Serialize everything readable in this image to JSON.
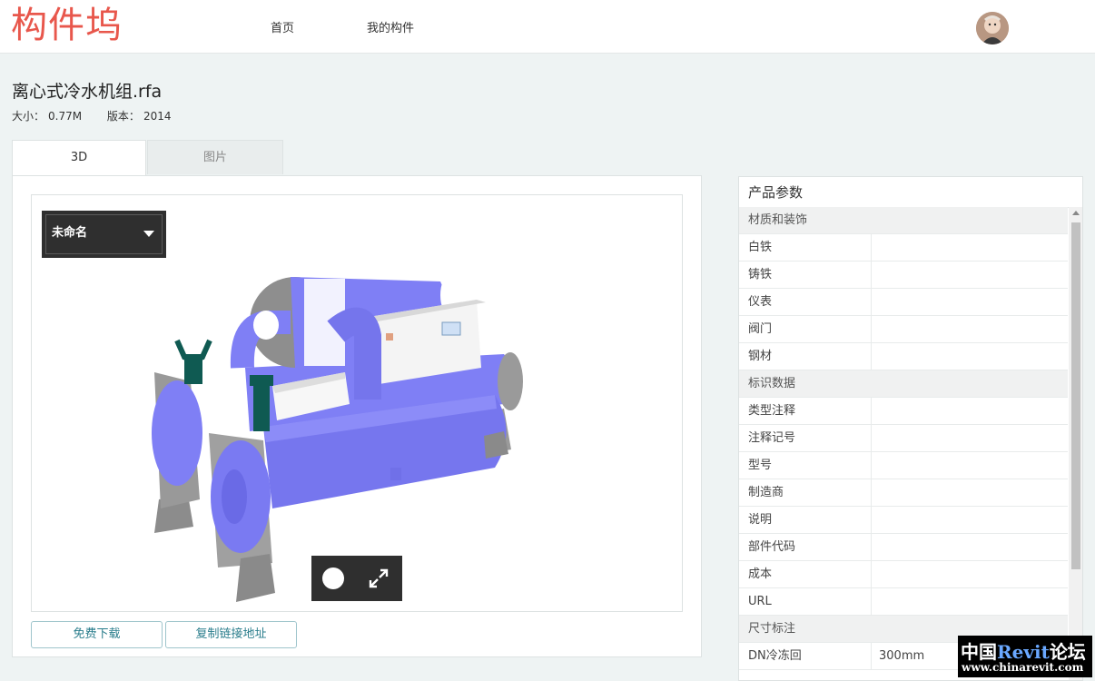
{
  "header": {
    "logo": "构件坞",
    "nav": [
      {
        "label": "首页"
      },
      {
        "label": "我的构件"
      }
    ]
  },
  "file": {
    "title": "离心式冷水机组.rfa",
    "size_label": "大小：",
    "size_value": "0.77M",
    "version_label": "版本：",
    "version_value": "2014"
  },
  "tabs": [
    {
      "label": "3D",
      "active": true
    },
    {
      "label": "图片",
      "active": false
    }
  ],
  "viewer": {
    "view_name": "未命名",
    "model_colors": {
      "shell": "#7f7ff5",
      "frame": "#9a9a9a",
      "valve": "#0f5a52",
      "panel": "#ffffff"
    }
  },
  "actions": {
    "download": "免费下载",
    "copy_link": "复制链接地址"
  },
  "params": {
    "title": "产品参数",
    "groups": [
      {
        "name": "材质和装饰",
        "rows": [
          {
            "k": "白铁",
            "v": ""
          },
          {
            "k": "铸铁",
            "v": ""
          },
          {
            "k": "仪表",
            "v": ""
          },
          {
            "k": "阀门",
            "v": ""
          },
          {
            "k": "钢材",
            "v": ""
          }
        ]
      },
      {
        "name": "标识数据",
        "rows": [
          {
            "k": "类型注释",
            "v": ""
          },
          {
            "k": "注释记号",
            "v": ""
          },
          {
            "k": "型号",
            "v": ""
          },
          {
            "k": "制造商",
            "v": ""
          },
          {
            "k": "说明",
            "v": ""
          },
          {
            "k": "部件代码",
            "v": ""
          },
          {
            "k": "成本",
            "v": ""
          },
          {
            "k": "URL",
            "v": ""
          }
        ]
      },
      {
        "name": "尺寸标注",
        "rows": [
          {
            "k": "DN冷冻回",
            "v": "300mm"
          }
        ]
      }
    ]
  },
  "watermark": {
    "line1_a": "中国",
    "line1_b": "Revit",
    "line1_c": "论坛",
    "line2": "www.chinarevit.com"
  }
}
